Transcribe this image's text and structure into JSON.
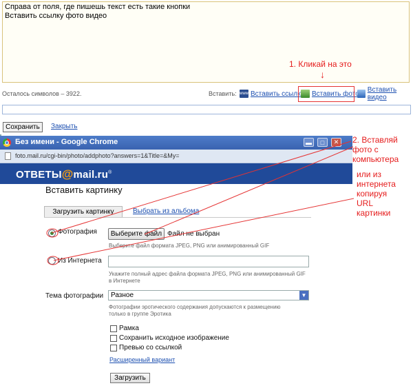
{
  "editor": {
    "lines": [
      "Справа от поля, где пишешь текст есть такие кнопки",
      "Вставить ссылку фото видео"
    ],
    "remaining": "Осталось символов – 3922.",
    "insert_label": "Вставить:",
    "insert_link": "Вставить ссылку",
    "insert_photo": "Вставить фото",
    "insert_video": "Вставить видео",
    "save": "Сохранить",
    "close": "Закрыть"
  },
  "annotations": {
    "step1": "1. Кликай на это",
    "arrow": "↓",
    "step2": [
      "2. Вставляй",
      "фото с",
      "компьютера"
    ],
    "step3": [
      "или из",
      "интернета",
      "копируя",
      "URL",
      "картинки"
    ]
  },
  "chrome": {
    "title": "Без имени - Google Chrome",
    "url": "foto.mail.ru/cgi-bin/photo/addphoto?answers=1&Title=&My=",
    "logo_prefix": "ОТВЕТЫ",
    "logo_at": "@",
    "logo_suffix": "mail.ru",
    "logo_mark": "®",
    "buttons": {
      "minimize": "▬",
      "maximize": "□",
      "close": "✕"
    }
  },
  "dialog": {
    "title": "Вставить картинку",
    "tab_upload": "Загрузить картинку",
    "tab_album": "Выбрать из альбома",
    "photo_label": "Фотография",
    "choose_file": "Выберите файл",
    "no_file": "Файл не выбран",
    "file_hint": "Выберите файл формата JPEG, PNG или анимированный GIF",
    "internet_label": "Из Интернета",
    "url_hint": [
      "Укажите полный адрес файла формата JPEG, PNG или анимированный GIF",
      "в Интернете"
    ],
    "topic_label": "Тема фотографии",
    "topic_value": "Разное",
    "topic_hint": [
      "Фотографии эротического содержания допускаются к размещению",
      "только в группе Эротика"
    ],
    "options": [
      "Рамка",
      "Сохранить исходное изображение",
      "Превью со ссылкой"
    ],
    "advanced": "Расширенный вариант",
    "upload": "Загрузить"
  },
  "colors": {
    "annotation": "#e51b1b",
    "brand": "#204a99",
    "link": "#1c4fb0",
    "titlebar": "#3a63b0"
  }
}
